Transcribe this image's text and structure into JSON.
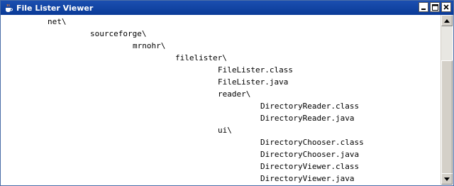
{
  "window": {
    "title": "File Lister Viewer",
    "icon": "java-cup-icon",
    "controls": [
      "minimize-icon",
      "maximize-icon",
      "close-icon"
    ]
  },
  "tree": {
    "lines": [
      {
        "text": "net\\",
        "depth": 1
      },
      {
        "text": "sourceforge\\",
        "depth": 2
      },
      {
        "text": "mrnohr\\",
        "depth": 3
      },
      {
        "text": "filelister\\",
        "depth": 4
      },
      {
        "text": "FileLister.class",
        "depth": 5
      },
      {
        "text": "FileLister.java",
        "depth": 5
      },
      {
        "text": "reader\\",
        "depth": 5
      },
      {
        "text": "DirectoryReader.class",
        "depth": 6
      },
      {
        "text": "DirectoryReader.java",
        "depth": 6
      },
      {
        "text": "ui\\",
        "depth": 5
      },
      {
        "text": "DirectoryChooser.class",
        "depth": 6
      },
      {
        "text": "DirectoryChooser.java",
        "depth": 6
      },
      {
        "text": "DirectoryViewer.class",
        "depth": 6
      },
      {
        "text": "DirectoryViewer.java",
        "depth": 6
      }
    ]
  },
  "scrollbar": {
    "icons": [
      "scroll-up-icon",
      "scroll-down-icon"
    ]
  }
}
